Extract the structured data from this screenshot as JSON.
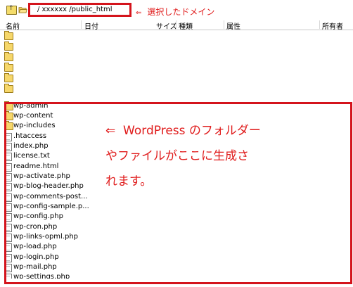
{
  "toolbar": {
    "path": "/ xxxxxx /public_html",
    "annotation_arrow": "⇐",
    "annotation_text": "選択したドメイン"
  },
  "columns": {
    "name": "名前",
    "date": "日付",
    "size": "サイズ",
    "type": "種類",
    "attr": "属性",
    "owner": "所有者"
  },
  "folders": [
    "",
    "",
    "",
    "",
    "",
    ""
  ],
  "items": [
    {
      "name": "wp-admin",
      "icon": "folder-icon"
    },
    {
      "name": "wp-content",
      "icon": "folder-icon"
    },
    {
      "name": "wp-includes",
      "icon": "folder-icon"
    },
    {
      "name": ".htaccess",
      "icon": "file-icon"
    },
    {
      "name": "index.php",
      "icon": "file-icon"
    },
    {
      "name": "license.txt",
      "icon": "file-icon"
    },
    {
      "name": "readme.html",
      "icon": "file-icon"
    },
    {
      "name": "wp-activate.php",
      "icon": "file-icon"
    },
    {
      "name": "wp-blog-header.php",
      "icon": "file-icon"
    },
    {
      "name": "wp-comments-post...",
      "icon": "file-icon"
    },
    {
      "name": "wp-config-sample.p...",
      "icon": "file-icon"
    },
    {
      "name": "wp-config.php",
      "icon": "file-icon"
    },
    {
      "name": "wp-cron.php",
      "icon": "file-icon"
    },
    {
      "name": "wp-links-opml.php",
      "icon": "file-icon"
    },
    {
      "name": "wp-load.php",
      "icon": "file-icon"
    },
    {
      "name": "wp-login.php",
      "icon": "file-icon"
    },
    {
      "name": "wp-mail.php",
      "icon": "file-icon"
    },
    {
      "name": "wp-settings.php",
      "icon": "file-icon"
    }
  ],
  "callout": {
    "line1": "⇐  WordPress のフォルダー",
    "line2": "やファイルがここに生成さ",
    "line3": "れます。"
  },
  "colors": {
    "highlight": "#d4141c",
    "annotation": "#e01c1c",
    "folder": "#f6d76a"
  }
}
